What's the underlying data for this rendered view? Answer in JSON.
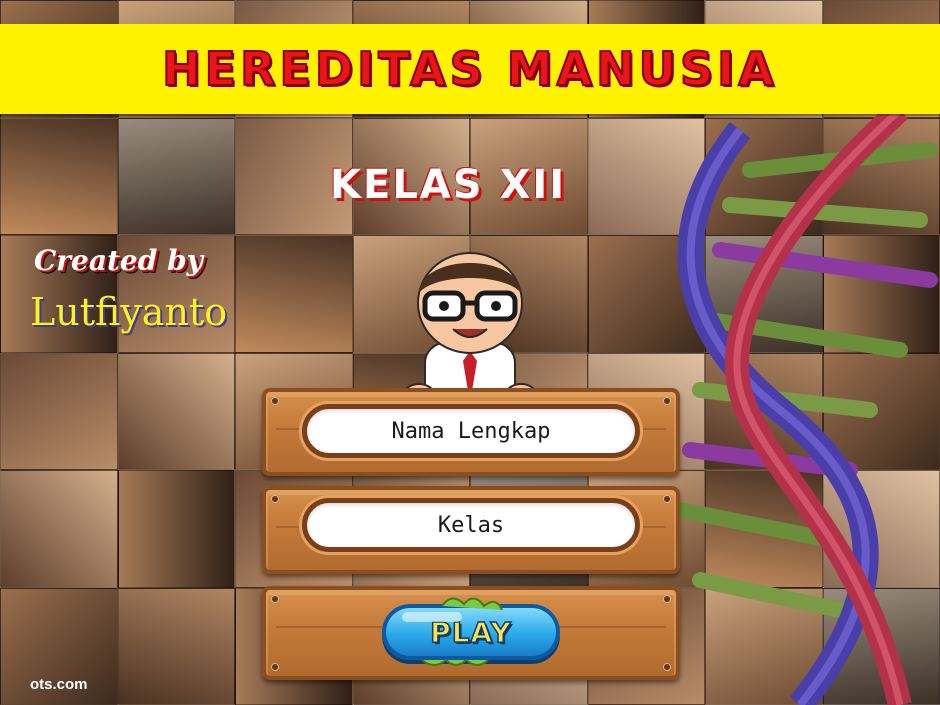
{
  "header": {
    "title": "HEREDITAS MANUSIA"
  },
  "subtitle": {
    "grade": "KELAS XII"
  },
  "credits": {
    "created_by": "Created by",
    "author": "Lutfiyanto"
  },
  "form": {
    "name_placeholder": "Nama Lengkap",
    "class_placeholder": "Kelas",
    "play_label": "PLAY"
  },
  "watermark": {
    "url": "ots.com"
  },
  "colors": {
    "title_bar": "#fff200",
    "title_text": "#e8151b",
    "board_wood": "#c47a3a",
    "play_button": "#2aa8e8"
  }
}
